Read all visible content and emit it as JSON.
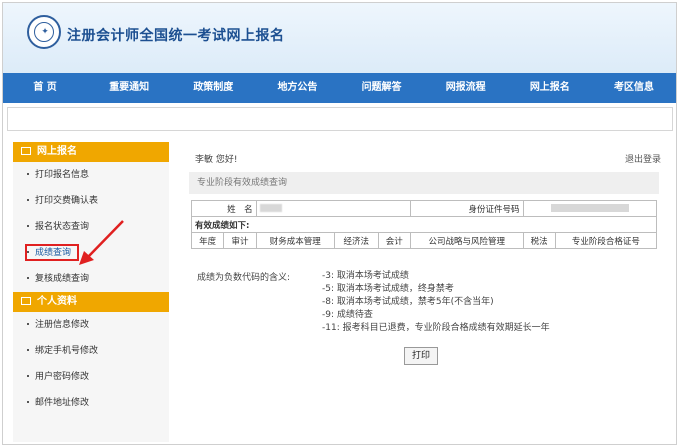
{
  "header": {
    "site_title": "注册会计师全国统一考试网上报名"
  },
  "nav": {
    "items": [
      "首 页",
      "重要通知",
      "政策制度",
      "地方公告",
      "问题解答",
      "网报流程",
      "网上报名",
      "考区信息"
    ]
  },
  "sidebar": {
    "section1": {
      "title": "网上报名",
      "items": [
        "打印报名信息",
        "打印交费确认表",
        "报名状态查询",
        "成绩查询",
        "复核成绩查询"
      ]
    },
    "section2": {
      "title": "个人资料",
      "items": [
        "注册信息修改",
        "绑定手机号修改",
        "用户密码修改",
        "邮件地址修改"
      ]
    },
    "active_item": "成绩查询"
  },
  "main": {
    "greeting": "李敏 您好!",
    "logout": "退出登录",
    "section_title": "专业阶段有效成绩查询",
    "name_label": "姓　名",
    "id_label": "身份证件号码",
    "valid_label": "有效成绩如下:",
    "columns": [
      "年度",
      "审计",
      "财务成本管理",
      "经济法",
      "会计",
      "公司战略与风险管理",
      "税法",
      "专业阶段合格证号"
    ],
    "legend_label": "成绩为负数代码的含义:",
    "codes": [
      "-3: 取消本场考试成绩",
      "-5: 取消本场考试成绩，终身禁考",
      "-8: 取消本场考试成绩，禁考5年(不含当年)",
      "-9: 成绩待查",
      "-11: 报考科目已退费，专业阶段合格成绩有效期延长一年"
    ],
    "print_label": "打印"
  },
  "colors": {
    "nav": "#2a73c3",
    "sidebar_head": "#f0a700",
    "annotation": "#e02020"
  }
}
